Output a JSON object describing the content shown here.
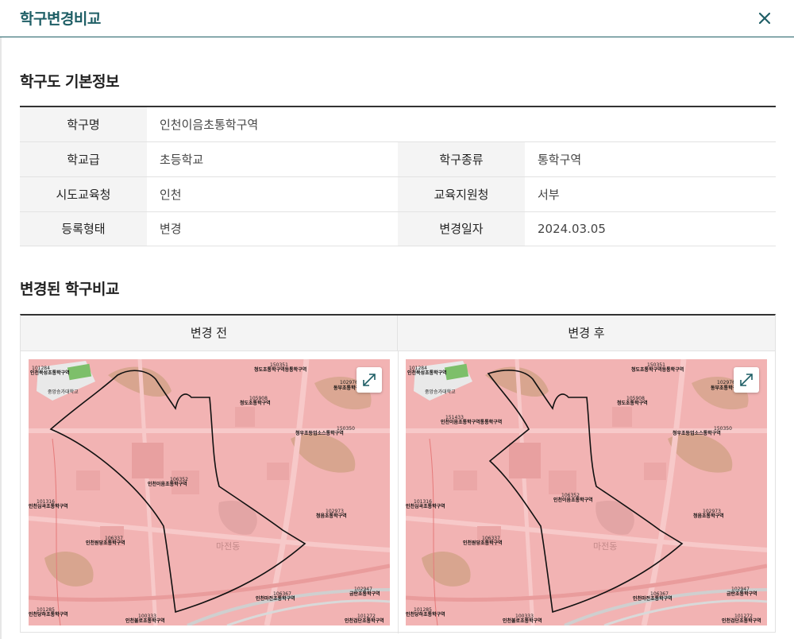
{
  "modal": {
    "title": "학구변경비교",
    "close_icon": "close-icon"
  },
  "basic_info": {
    "section_title": "학구도 기본정보",
    "rows": [
      {
        "label1": "학구명",
        "value1": "인천이음초통학구역"
      },
      {
        "label1": "학교급",
        "value1": "초등학교",
        "label2": "학구종류",
        "value2": "통학구역"
      },
      {
        "label1": "시도교육청",
        "value1": "인천",
        "label2": "교육지원청",
        "value2": "서부"
      },
      {
        "label1": "등록형태",
        "value1": "변경",
        "label2": "변경일자",
        "value2": "2024.03.05"
      }
    ]
  },
  "compare": {
    "section_title": "변경된 학구비교",
    "before_label": "변경 전",
    "after_label": "변경 후",
    "expand_icon": "expand-icon",
    "colors": {
      "accent": "#1f5f66",
      "map_fill": "#f2b3b3",
      "park": "#d8a58f",
      "road": "#f7c9c9",
      "boundary": "#111111"
    },
    "map_labels": {
      "l101284": "101284",
      "l_school1": "인천북성초통학구역",
      "l_uni": "중앙승가대학교",
      "l150351": "150351",
      "l_zone2": "청도초통학구역등통학구역",
      "l102976": "102976",
      "l_zone3": "동부초통학구",
      "l105908": "105908",
      "l_zone4": "청도초통학구역",
      "l150350": "150350",
      "l_zone5": "청우초등업소스통학구역",
      "l106352": "106352",
      "l_zone_target": "인천이음초통학구역",
      "l101316": "101316",
      "l_zone7": "인천심곡초통학구역",
      "l102973": "102973",
      "l_zone8": "청음초통학구역",
      "l106337": "106337",
      "l_zone9": "인천원당초통학구역",
      "l106367": "106367",
      "l_zone10": "인천마전초통학구역",
      "l102947": "102947",
      "l_zone11": "금란초통학구역",
      "l101285": "101285",
      "l_zone12": "인천당하초통학구역",
      "l100333": "100333",
      "l_zone13": "인천불로초통학구역",
      "l101272": "101272",
      "l_zone14": "인천검단초통학구역",
      "l151433": "151433",
      "l_zone_new": "인천이음초통학구역통통학구역",
      "l_area": "마전동"
    }
  }
}
